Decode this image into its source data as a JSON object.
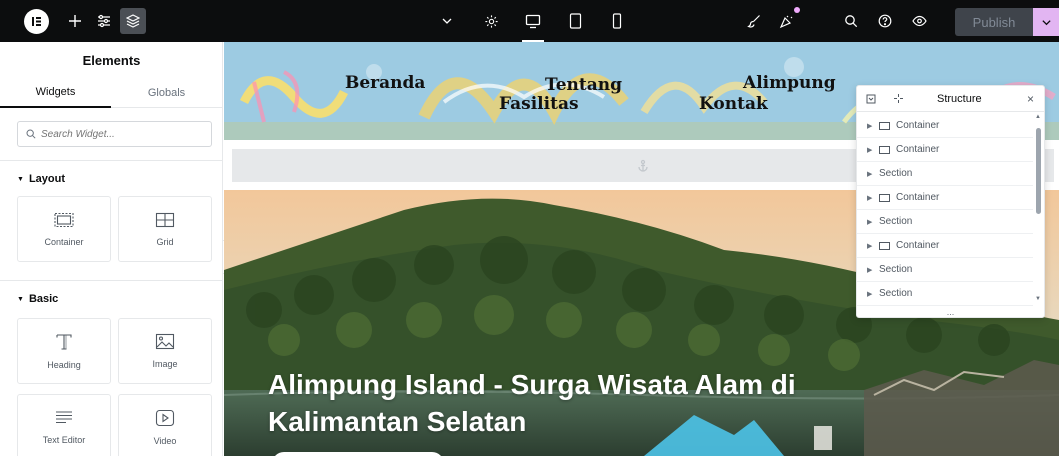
{
  "topbar": {
    "add_icon": "plus-icon",
    "settings_icon": "sliders-icon",
    "layers_icon": "layers-icon",
    "page_dropdown_icon": "chevron-down-icon",
    "site_settings_icon": "gear-icon",
    "devices": [
      "desktop",
      "tablet",
      "mobile"
    ],
    "active_device": "desktop",
    "publish_label": "Publish",
    "colors": {
      "bar": "#0c0d0e",
      "publish_bg": "#3f444b",
      "publish_caret_bg": "#e2b5f2"
    }
  },
  "panel": {
    "title": "Elements",
    "tabs": [
      {
        "label": "Widgets",
        "active": true
      },
      {
        "label": "Globals",
        "active": false
      }
    ],
    "search_placeholder": "Search Widget...",
    "categories": [
      {
        "name": "Layout",
        "widgets": [
          {
            "label": "Container",
            "icon": "container-icon"
          },
          {
            "label": "Grid",
            "icon": "grid-icon"
          }
        ]
      },
      {
        "name": "Basic",
        "widgets": [
          {
            "label": "Heading",
            "icon": "heading-icon"
          },
          {
            "label": "Image",
            "icon": "image-icon"
          },
          {
            "label": "Text Editor",
            "icon": "text-editor-icon"
          },
          {
            "label": "Video",
            "icon": "video-icon"
          }
        ]
      }
    ]
  },
  "canvas": {
    "nav": {
      "beranda": "Beranda",
      "tentang": "Tentang",
      "fasilitas": "Fasilitas",
      "alimpung": "Alimpung",
      "kontak": "Kontak"
    },
    "hero_title": "Alimpung Island - Surga Wisata Alam di Kalimantan Selatan"
  },
  "structure": {
    "title": "Structure",
    "rows": [
      {
        "label": "Container",
        "type": "container"
      },
      {
        "label": "Container",
        "type": "container"
      },
      {
        "label": "Section",
        "type": "section"
      },
      {
        "label": "Container",
        "type": "container"
      },
      {
        "label": "Section",
        "type": "section"
      },
      {
        "label": "Container",
        "type": "container"
      },
      {
        "label": "Section",
        "type": "section"
      },
      {
        "label": "Section",
        "type": "section"
      }
    ],
    "footer": "..."
  }
}
